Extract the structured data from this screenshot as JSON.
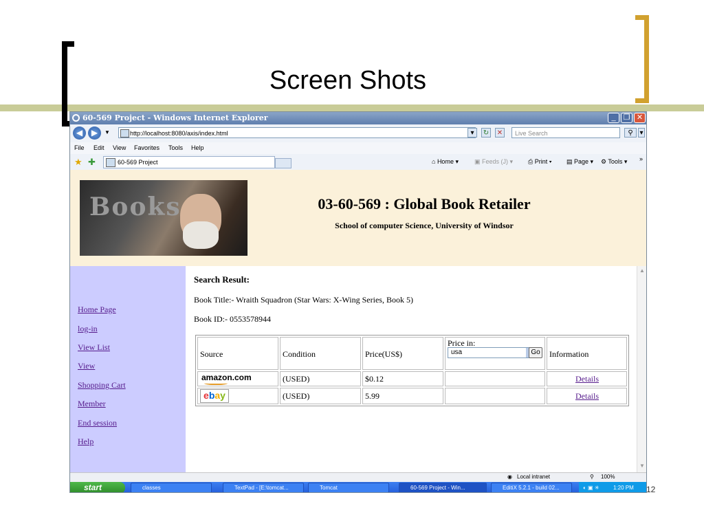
{
  "slide": {
    "title": "Screen Shots",
    "page_number": "12"
  },
  "window": {
    "title": "60-569 Project - Windows Internet Explorer",
    "address": "http://localhost:8080/axis/index.html",
    "search_placeholder": "Live Search",
    "menu": [
      "File",
      "Edit",
      "View",
      "Favorites",
      "Tools",
      "Help"
    ],
    "tab_label": "60-569 Project",
    "toolbar": {
      "home": "Home",
      "feeds": "Feeds (J)",
      "print": "Print",
      "page": "Page",
      "tools": "Tools"
    }
  },
  "site": {
    "logo_text": "Books",
    "title": "03-60-569 : Global Book Retailer",
    "subtitle": "School of computer Science, University of Windsor"
  },
  "sidebar": {
    "items": [
      "Home Page",
      "log-in",
      "View List",
      "View",
      "Shopping Cart",
      "Member",
      "End session",
      "Help"
    ]
  },
  "result": {
    "heading": "Search Result:",
    "book_title": "Book Title:- Wraith Squadron (Star Wars: X-Wing Series, Book 5)",
    "book_id": "Book ID:- 0553578944",
    "columns": {
      "source": "Source",
      "condition": "Condition",
      "price": "Price(US$)",
      "price_in": "Price in:",
      "information": "Information"
    },
    "currency_selected": "usa",
    "go_label": "Go",
    "rows": [
      {
        "source": "amazon.com",
        "condition": "(USED)",
        "price": "$0.12",
        "details": "Details"
      },
      {
        "source": "ebay",
        "condition": "(USED)",
        "price": "5.99",
        "details": "Details"
      }
    ]
  },
  "status": {
    "zone": "Local intranet",
    "zoom": "100%"
  },
  "taskbar": {
    "start": "start",
    "items": [
      "classes",
      "TextPad - [E:\\tomcat...",
      "Tomcat",
      "60-569 Project - Win...",
      "EditiX 5.2.1 - build 02..."
    ],
    "clock": "1:20 PM"
  }
}
